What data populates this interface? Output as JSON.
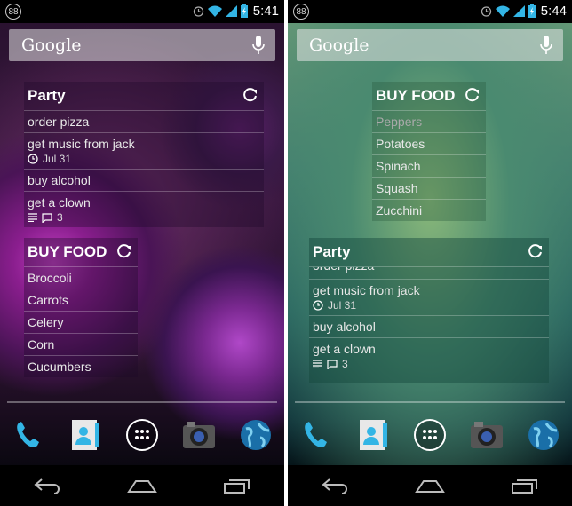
{
  "screens": [
    {
      "statusbar": {
        "notification_count": "88",
        "time": "5:41"
      },
      "search": {
        "logo": "Google"
      },
      "widgets": [
        {
          "title": "Party",
          "items": [
            {
              "text": "order pizza"
            },
            {
              "text": "get music from jack",
              "date": "Jul 31"
            },
            {
              "text": "buy alcohol"
            },
            {
              "text": "get a clown",
              "comments": "3"
            }
          ]
        },
        {
          "title": "BUY FOOD",
          "items": [
            {
              "text": "Broccoli"
            },
            {
              "text": "Carrots"
            },
            {
              "text": "Celery"
            },
            {
              "text": "Corn"
            },
            {
              "text": "Cucumbers"
            }
          ]
        }
      ]
    },
    {
      "statusbar": {
        "notification_count": "88",
        "time": "5:44"
      },
      "search": {
        "logo": "Google"
      },
      "widgets": [
        {
          "title": "BUY FOOD",
          "items": [
            {
              "text": "Peppers"
            },
            {
              "text": "Potatoes"
            },
            {
              "text": "Spinach"
            },
            {
              "text": "Squash"
            },
            {
              "text": "Zucchini"
            }
          ]
        },
        {
          "title": "Party",
          "items": [
            {
              "text": "order pizza"
            },
            {
              "text": "get music from jack",
              "date": "Jul 31"
            },
            {
              "text": "buy alcohol"
            },
            {
              "text": "get a clown",
              "comments": "3"
            }
          ]
        }
      ]
    }
  ],
  "dock": [
    "phone",
    "contacts",
    "app-drawer",
    "camera",
    "browser"
  ],
  "navbar": [
    "back",
    "home",
    "recent-apps"
  ]
}
